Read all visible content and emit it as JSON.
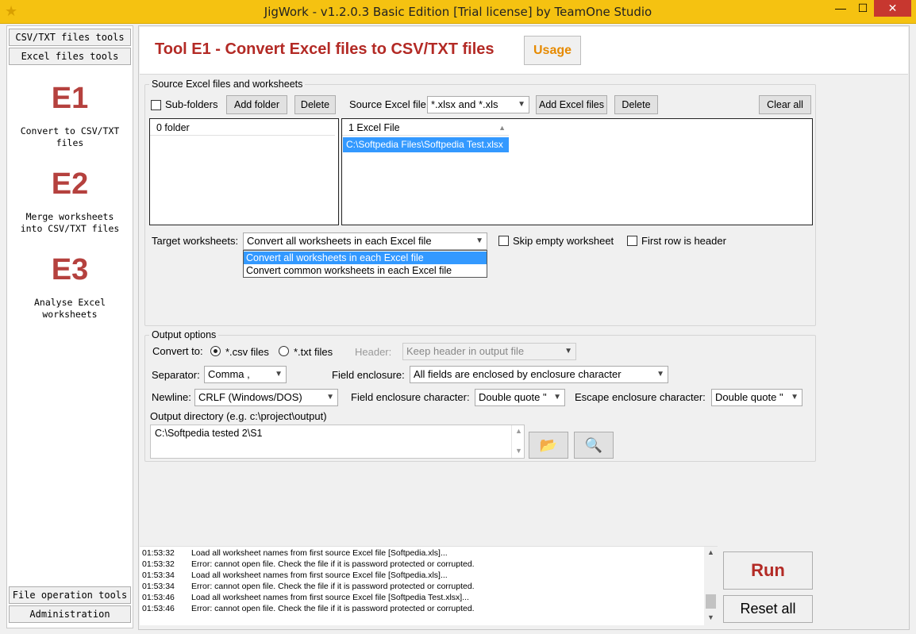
{
  "window": {
    "title": "JigWork - v1.2.0.3 Basic Edition [Trial license] by TeamOne Studio",
    "app_icon": "star-icon",
    "minimize": "—",
    "maximize": "☐",
    "close": "✕"
  },
  "leftnav": {
    "tab_csv": "CSV/TXT files tools",
    "tab_excel": "Excel files tools",
    "tools": [
      {
        "code": "E1",
        "desc1": "Convert to CSV/TXT",
        "desc2": "files"
      },
      {
        "code": "E2",
        "desc1": "Merge worksheets",
        "desc2": "into CSV/TXT files"
      },
      {
        "code": "E3",
        "desc1": "Analyse Excel",
        "desc2": "worksheets"
      }
    ],
    "tab_file_ops": "File operation tools",
    "tab_admin": "Administration"
  },
  "header": {
    "title": "Tool E1 - Convert Excel files to CSV/TXT files",
    "usage": "Usage"
  },
  "source": {
    "group_label": "Source Excel files and worksheets",
    "subfolders_label": "Sub-folders",
    "add_folder": "Add folder",
    "delete_folder": "Delete",
    "source_file_label": "Source Excel file:",
    "source_file_filter": "*.xlsx and *.xls",
    "add_excel_files": "Add Excel files",
    "delete_file": "Delete",
    "clear_all": "Clear all",
    "folder_list_header": "0 folder",
    "file_list_header": "1 Excel File",
    "files": [
      "C:\\Softpedia Files\\Softpedia Test.xlsx"
    ],
    "target_label": "Target worksheets:",
    "target_value": "Convert all worksheets in each Excel file",
    "target_options": [
      "Convert all worksheets in each Excel file",
      "Convert common worksheets in each Excel file"
    ],
    "skip_empty": "Skip empty worksheet",
    "first_row_header": "First row is header"
  },
  "output": {
    "group_label": "Output options",
    "convert_to_label": "Convert to:",
    "csv_label": "*.csv files",
    "txt_label": "*.txt files",
    "header_label": "Header:",
    "header_value": "Keep header in output file",
    "separator_label": "Separator:",
    "separator_value": "Comma  ,",
    "field_enclosure_label": "Field enclosure:",
    "field_enclosure_value": "All fields are enclosed by enclosure character",
    "newline_label": "Newline:",
    "newline_value": "CRLF (Windows/DOS)",
    "enclosure_char_label": "Field enclosure character:",
    "enclosure_char_value": "Double quote  \"",
    "escape_char_label": "Escape enclosure character:",
    "escape_char_value": "Double quote  \"",
    "output_dir_label": "Output directory (e.g. c:\\project\\output)",
    "output_dir_value": "C:\\Softpedia tested 2\\S1"
  },
  "log": [
    {
      "time": "01:53:32",
      "msg": "Load all worksheet names from first source Excel file [Softpedia.xls]..."
    },
    {
      "time": "01:53:32",
      "msg": "Error: cannot open file. Check the file if it is password protected or corrupted."
    },
    {
      "time": "01:53:34",
      "msg": "Load all worksheet names from first source Excel file [Softpedia.xls]..."
    },
    {
      "time": "01:53:34",
      "msg": "Error: cannot open file. Check the file if it is password protected or corrupted."
    },
    {
      "time": "01:53:46",
      "msg": "Load all worksheet names from first source Excel file [Softpedia Test.xlsx]..."
    },
    {
      "time": "01:53:46",
      "msg": "Error: cannot open file. Check the file if it is password protected or corrupted."
    }
  ],
  "actions": {
    "run": "Run",
    "reset_all": "Reset all"
  }
}
